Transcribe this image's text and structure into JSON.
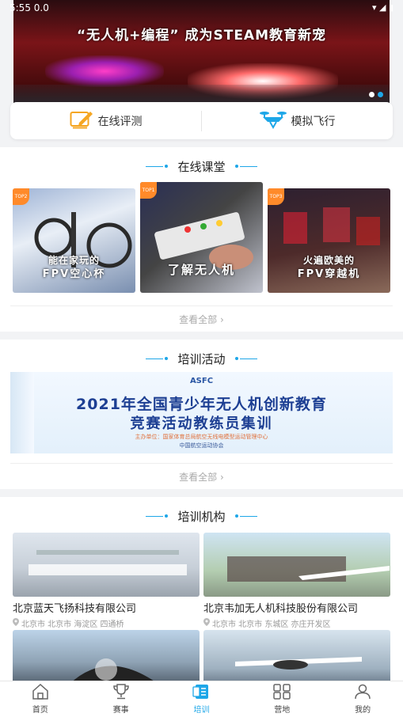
{
  "status": {
    "time": "5:55 0.0",
    "icons": "▾ ◢ ▮"
  },
  "banner": {
    "title": "“无人机+编程” 成为STEAM教育新宠",
    "slide_count": 2,
    "active_slide": 2
  },
  "quick_actions": [
    {
      "label": "在线评测",
      "icon": "pencil-edit-icon"
    },
    {
      "label": "模拟飞行",
      "icon": "drone-icon"
    }
  ],
  "online_courses": {
    "title": "在线课堂",
    "view_all": "查看全部 ",
    "cards": [
      {
        "badge": "TOP2",
        "caption1": "能在家玩的",
        "caption2": "FPV空心杯"
      },
      {
        "badge": "TOP1",
        "caption1": "",
        "caption2": "了解无人机"
      },
      {
        "badge": "TOP3",
        "caption1": "火遍欧美的",
        "caption2": "FPV穿越机"
      }
    ]
  },
  "training_activities": {
    "title": "培训活动",
    "view_all": "查看全部 ",
    "banner_logo": "ASFC",
    "banner_title1": "2021年全国青少年无人机创新教育",
    "banner_title2": "竞赛活动教练员集训",
    "banner_sub1": "主办单位：国家体育总局航空无线电模型运动管理中心",
    "banner_sub2": "中国航空运动协会"
  },
  "institutions": {
    "title": "培训机构",
    "items": [
      {
        "name": "北京蓝天飞扬科技有限公司",
        "location": "北京市 北京市 海淀区 四通桥"
      },
      {
        "name": "北京韦加无人机科技股份有限公司",
        "location": "北京市 北京市 东城区 亦庄开发区"
      },
      {
        "name": "",
        "location": ""
      },
      {
        "name": "",
        "location": ""
      }
    ]
  },
  "tabs": [
    {
      "label": "首页",
      "icon": "home-icon",
      "active": false
    },
    {
      "label": "赛事",
      "icon": "trophy-icon",
      "active": false
    },
    {
      "label": "培训",
      "icon": "training-icon",
      "active": true
    },
    {
      "label": "营地",
      "icon": "camp-grid-icon",
      "active": false
    },
    {
      "label": "我的",
      "icon": "user-icon",
      "active": false
    }
  ],
  "colors": {
    "accent": "#1ea7e8",
    "badge": "#ff8a2a",
    "background": "#f2f3f5"
  }
}
